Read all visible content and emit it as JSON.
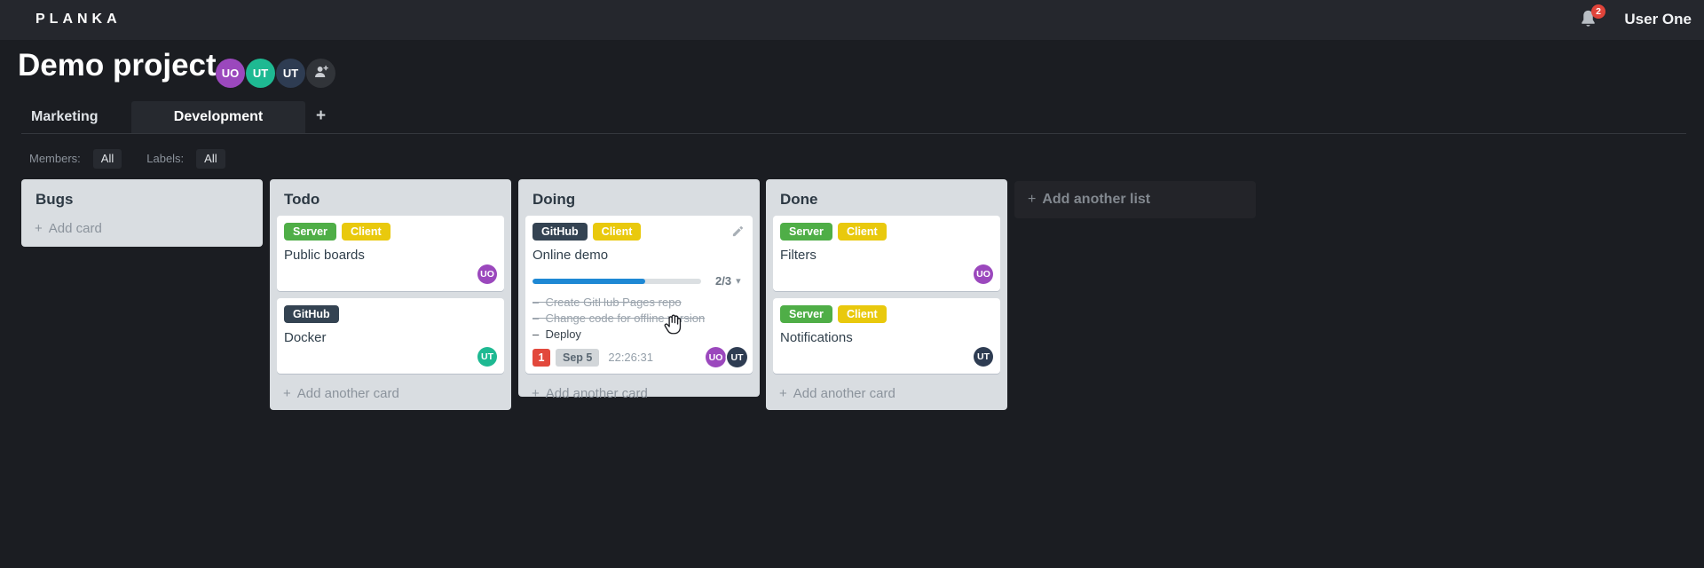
{
  "topbar": {
    "logo": "PLANKA",
    "notification_count": "2",
    "user_name": "User One"
  },
  "project": {
    "title": "Demo project",
    "members": [
      {
        "initials": "UO",
        "color": "#9b48bd"
      },
      {
        "initials": "UT",
        "color": "#1eb992"
      },
      {
        "initials": "UT",
        "color": "#2e3c52"
      }
    ]
  },
  "tabs": {
    "items": [
      {
        "label": "Marketing",
        "active": false
      },
      {
        "label": "Development",
        "active": true
      }
    ],
    "add_label": "+"
  },
  "filters": {
    "members_label": "Members:",
    "members_value": "All",
    "labels_label": "Labels:",
    "labels_value": "All"
  },
  "board": {
    "add_list_label": "Add another list",
    "lists": [
      {
        "name": "Bugs",
        "add_card_label": "Add card",
        "cards": []
      },
      {
        "name": "Todo",
        "add_card_label": "Add another card",
        "cards": [
          {
            "title": "Public boards",
            "labels": [
              {
                "text": "Server",
                "color": "#4fae47"
              },
              {
                "text": "Client",
                "color": "#e9c90d"
              }
            ],
            "members": [
              {
                "initials": "UO",
                "color": "#9b48bd"
              }
            ]
          },
          {
            "title": "Docker",
            "labels": [
              {
                "text": "GitHub",
                "color": "#344352"
              }
            ],
            "members": [
              {
                "initials": "UT",
                "color": "#1eb992"
              }
            ]
          }
        ]
      },
      {
        "name": "Doing",
        "add_card_label": "Add another card",
        "cards": [
          {
            "title": "Online demo",
            "labels": [
              {
                "text": "GitHub",
                "color": "#344352"
              },
              {
                "text": "Client",
                "color": "#e9c90d"
              }
            ],
            "progress": {
              "label": "2/3",
              "done": 2,
              "total": 3,
              "percent": "66.7%"
            },
            "tasks": [
              {
                "text": "Create GitHub Pages repo",
                "done": true
              },
              {
                "text": "Change code for offline version",
                "done": true
              },
              {
                "text": "Deploy",
                "done": false
              }
            ],
            "badges": {
              "count": "1",
              "due_date": "Sep 5",
              "timer": "22:26:31"
            },
            "members": [
              {
                "initials": "UO",
                "color": "#9b48bd"
              },
              {
                "initials": "UT",
                "color": "#2e3c52"
              }
            ]
          }
        ]
      },
      {
        "name": "Done",
        "add_card_label": "Add another card",
        "cards": [
          {
            "title": "Filters",
            "labels": [
              {
                "text": "Server",
                "color": "#4fae47"
              },
              {
                "text": "Client",
                "color": "#e9c90d"
              }
            ],
            "members": [
              {
                "initials": "UO",
                "color": "#9b48bd"
              }
            ]
          },
          {
            "title": "Notifications",
            "labels": [
              {
                "text": "Server",
                "color": "#4fae47"
              },
              {
                "text": "Client",
                "color": "#e9c90d"
              }
            ],
            "members": [
              {
                "initials": "UT",
                "color": "#2e3c52"
              }
            ]
          }
        ]
      }
    ]
  },
  "colors": {
    "topbar_bg": "#25272d",
    "board_bg": "#1b1d22",
    "list_bg": "#d9dde1",
    "progress_blue": "#1e88d4",
    "alert_red": "#e0443a"
  }
}
